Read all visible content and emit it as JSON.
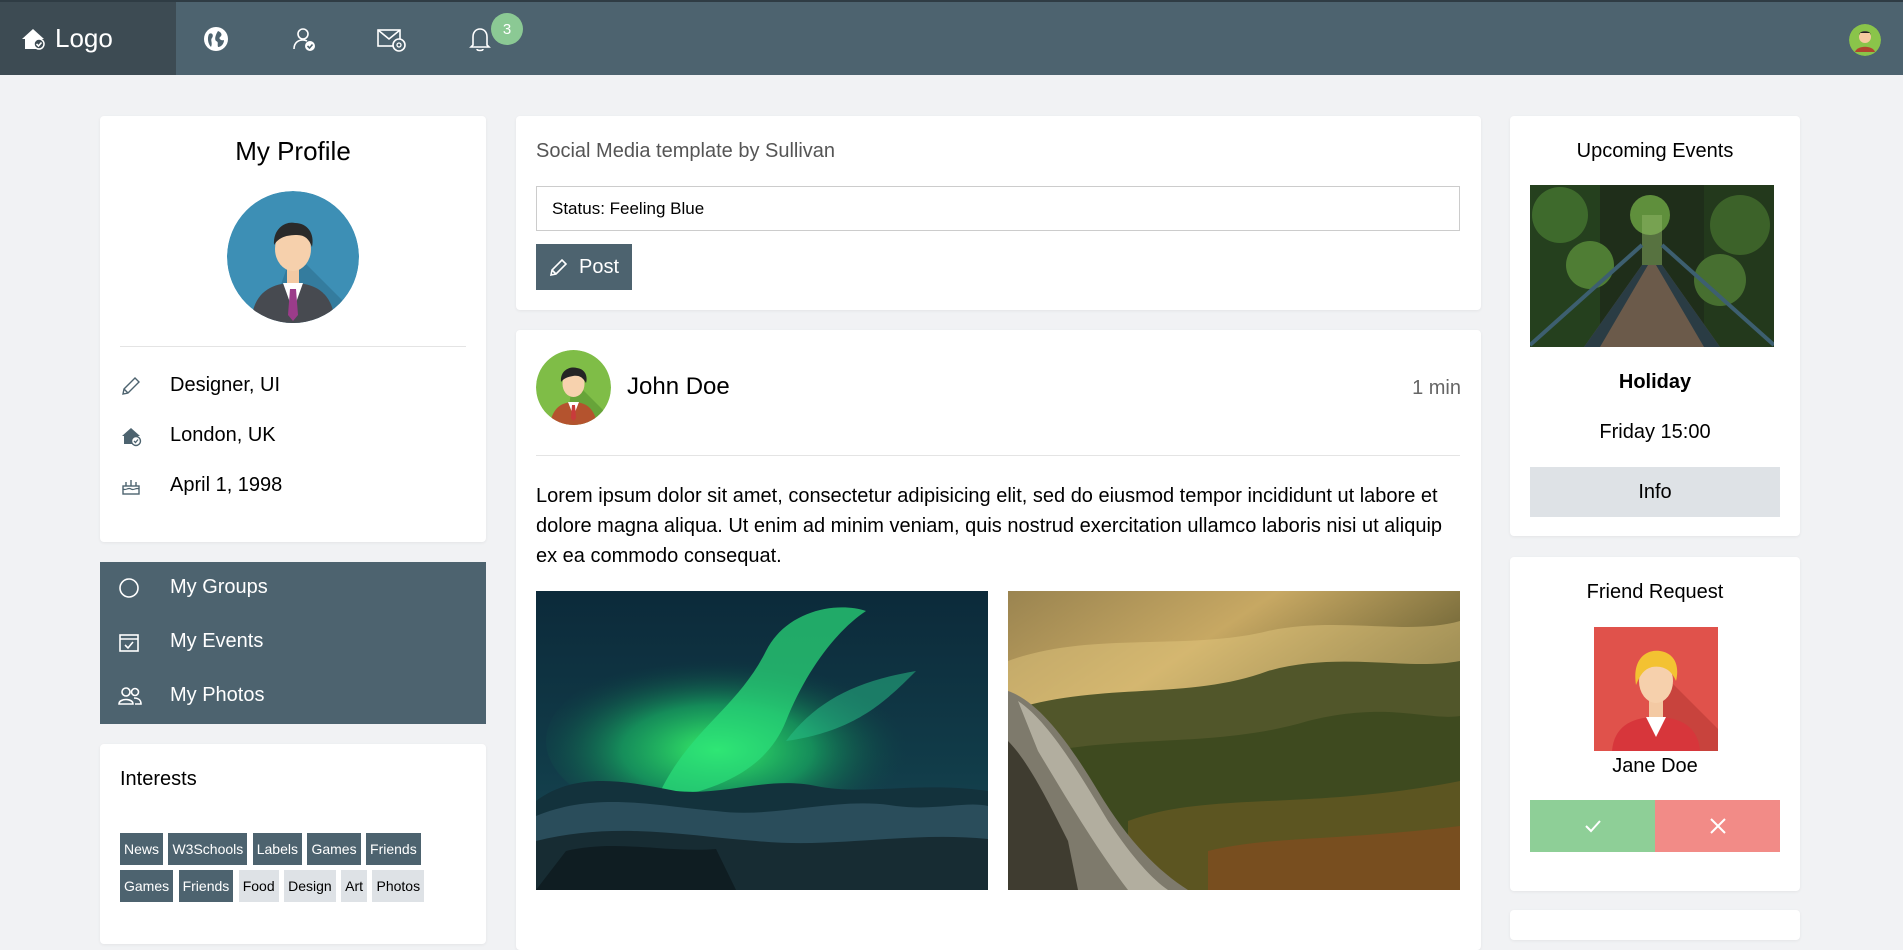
{
  "nav": {
    "logo_label": "Logo",
    "icons": [
      "globe-icon",
      "user-check-icon",
      "mail-icon",
      "bell-icon"
    ],
    "notification_count": "3",
    "accent": "#4d636f"
  },
  "profile": {
    "title": "My Profile",
    "info": [
      {
        "icon": "pencil-icon",
        "text": "Designer, UI"
      },
      {
        "icon": "home-icon",
        "text": "London, UK"
      },
      {
        "icon": "cake-icon",
        "text": "April 1, 1998"
      }
    ]
  },
  "menu": {
    "items": [
      {
        "icon": "circle-icon",
        "label": "My Groups"
      },
      {
        "icon": "calendar-icon",
        "label": "My Events"
      },
      {
        "icon": "users-icon",
        "label": "My Photos"
      }
    ]
  },
  "interests": {
    "title": "Interests",
    "tags": [
      "News",
      "W3Schools",
      "Labels",
      "Games",
      "Friends",
      "Games",
      "Friends",
      "Food",
      "Design",
      "Art",
      "Photos"
    ]
  },
  "composer": {
    "subtitle": "Social Media template by Sullivan",
    "status_value": "Status: Feeling Blue",
    "post_label": "Post"
  },
  "post": {
    "author": "John Doe",
    "time": "1 min",
    "body": "Lorem ipsum dolor sit amet, consectetur adipisicing elit, sed do eiusmod tempor incididunt ut labore et dolore magna aliqua. Ut enim ad minim veniam, quis nostrud exercitation ullamco laboris nisi ut aliquip ex ea commodo consequat."
  },
  "events": {
    "title": "Upcoming Events",
    "name": "Holiday",
    "when": "Friday 15:00",
    "button": "Info"
  },
  "friend_request": {
    "title": "Friend Request",
    "name": "Jane Doe",
    "accept_color": "#8ecf97",
    "decline_color": "#f28b87"
  }
}
